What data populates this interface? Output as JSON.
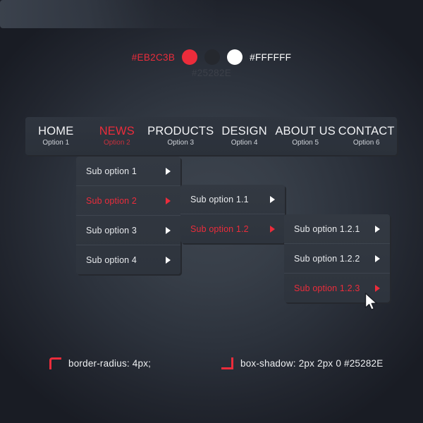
{
  "palette": {
    "accent": "#EB2C3B",
    "dark": "#25282E",
    "white": "#FFFFFF",
    "panel_bg": "#333942",
    "menu_bg": "#2F353F",
    "text": "#E9EBEE"
  },
  "swatches": {
    "accent_label": "#EB2C3B",
    "dark_label": "#25282E",
    "white_label": "#FFFFFF",
    "dots": [
      "accent-dot",
      "dark-dot",
      "white-dot"
    ]
  },
  "menubar": {
    "items": [
      {
        "title": "HOME",
        "sub": "Option 1",
        "active": false
      },
      {
        "title": "NEWS",
        "sub": "Option 2",
        "active": true
      },
      {
        "title": "PRODUCTS",
        "sub": "Option 3",
        "active": false
      },
      {
        "title": "DESIGN",
        "sub": "Option 4",
        "active": false
      },
      {
        "title": "ABOUT US",
        "sub": "Option 5",
        "active": false
      },
      {
        "title": "CONTACT",
        "sub": "Option 6",
        "active": false
      }
    ]
  },
  "submenu_1": {
    "items": [
      {
        "label": "Sub option 1",
        "active": false,
        "arrow": "caret-right-icon"
      },
      {
        "label": "Sub option 2",
        "active": true,
        "arrow": "caret-right-icon"
      },
      {
        "label": "Sub option 3",
        "active": false,
        "arrow": "caret-right-icon"
      },
      {
        "label": "Sub option 4",
        "active": false,
        "arrow": "caret-right-icon"
      }
    ]
  },
  "submenu_2": {
    "items": [
      {
        "label": "Sub option 1.1",
        "active": false,
        "arrow": "caret-right-icon"
      },
      {
        "label": "Sub option 1.2",
        "active": true,
        "arrow": "caret-right-icon"
      }
    ]
  },
  "submenu_3": {
    "items": [
      {
        "label": "Sub option 1.2.1",
        "active": false,
        "arrow": "caret-right-icon"
      },
      {
        "label": "Sub option 1.2.2",
        "active": false,
        "arrow": "caret-right-icon"
      },
      {
        "label": "Sub option 1.2.3",
        "active": true,
        "arrow": "caret-right-icon"
      }
    ]
  },
  "notes": {
    "radius": "border-radius: 4px;",
    "shadow": "box-shadow: 2px 2px 0 #25282E"
  },
  "cursor": {
    "name": "mouse-pointer"
  }
}
